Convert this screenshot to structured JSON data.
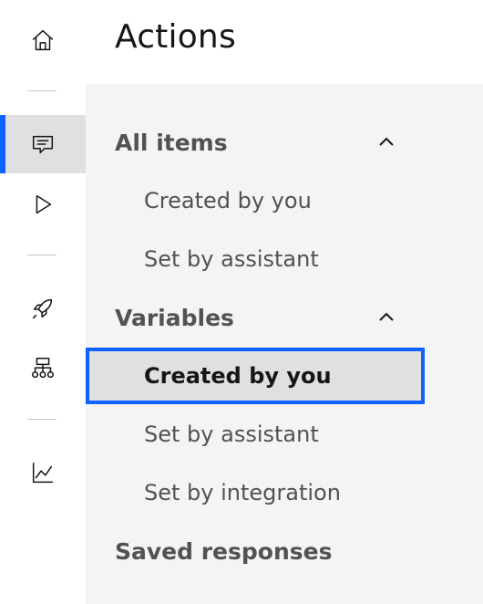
{
  "page": {
    "title": "Actions"
  },
  "rail": {
    "items": [
      {
        "name": "home",
        "icon": "home-icon"
      },
      {
        "name": "actions",
        "icon": "chat-icon",
        "active": true
      },
      {
        "name": "preview",
        "icon": "play-icon"
      },
      {
        "name": "publish",
        "icon": "rocket-icon"
      },
      {
        "name": "integrations",
        "icon": "hierarchy-icon"
      },
      {
        "name": "analytics",
        "icon": "chart-line-icon"
      }
    ]
  },
  "nav": {
    "all_items": {
      "label": "All items",
      "expanded": true,
      "children": [
        "Created by you",
        "Set by assistant"
      ]
    },
    "variables": {
      "label": "Variables",
      "expanded": true,
      "children": [
        "Created by you",
        "Set by assistant",
        "Set by integration"
      ],
      "selected_index": 0
    },
    "saved_responses": {
      "label": "Saved responses"
    }
  },
  "colors": {
    "accent": "#0f62fe",
    "panel_bg": "#f4f4f4",
    "selected_bg": "#e0e0e0",
    "text_secondary": "#525252"
  }
}
